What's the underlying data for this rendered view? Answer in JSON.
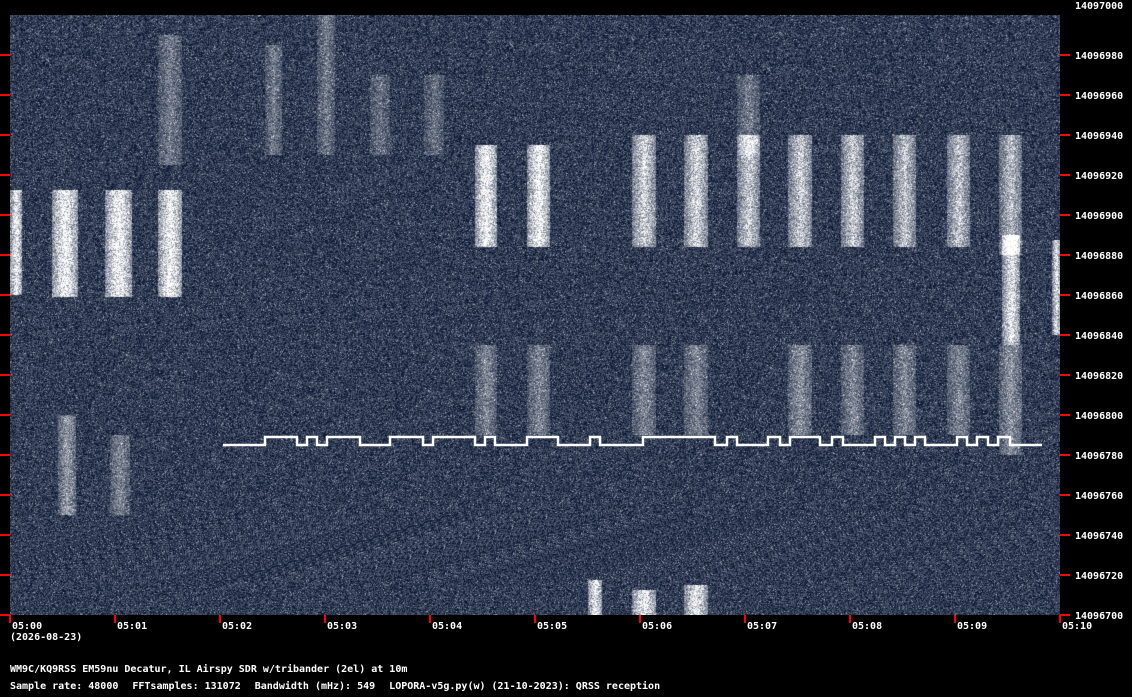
{
  "frequency_axis": {
    "top": "14097000",
    "labels": [
      "14096980",
      "14096960",
      "14096940",
      "14096920",
      "14096900",
      "14096880",
      "14096860",
      "14096840",
      "14096820",
      "14096800",
      "14096780",
      "14096760",
      "14096740",
      "14096720",
      "14096700"
    ]
  },
  "time_axis": {
    "labels": [
      "05:00",
      "05:01",
      "05:02",
      "05:03",
      "05:04",
      "05:05",
      "05:06",
      "05:07",
      "05:08",
      "05:09",
      "05:10"
    ]
  },
  "date": "(2026-08-23)",
  "station_line": "WM9C/KQ9RSS EM59nu Decatur, IL  Airspy SDR w/tribander (2el) at 10m",
  "info": {
    "sample_rate": "Sample rate: 48000",
    "fft_samples": "FFTsamples: 131072",
    "bandwidth": "Bandwidth (mHz): 549",
    "software": "LOPORA-v5g.py(w) (21-10-2023): QRSS reception"
  },
  "colors": {
    "background": "#03112e",
    "signal": "#ffffff",
    "tick": "#ff0000",
    "text": "#ffffff"
  }
}
